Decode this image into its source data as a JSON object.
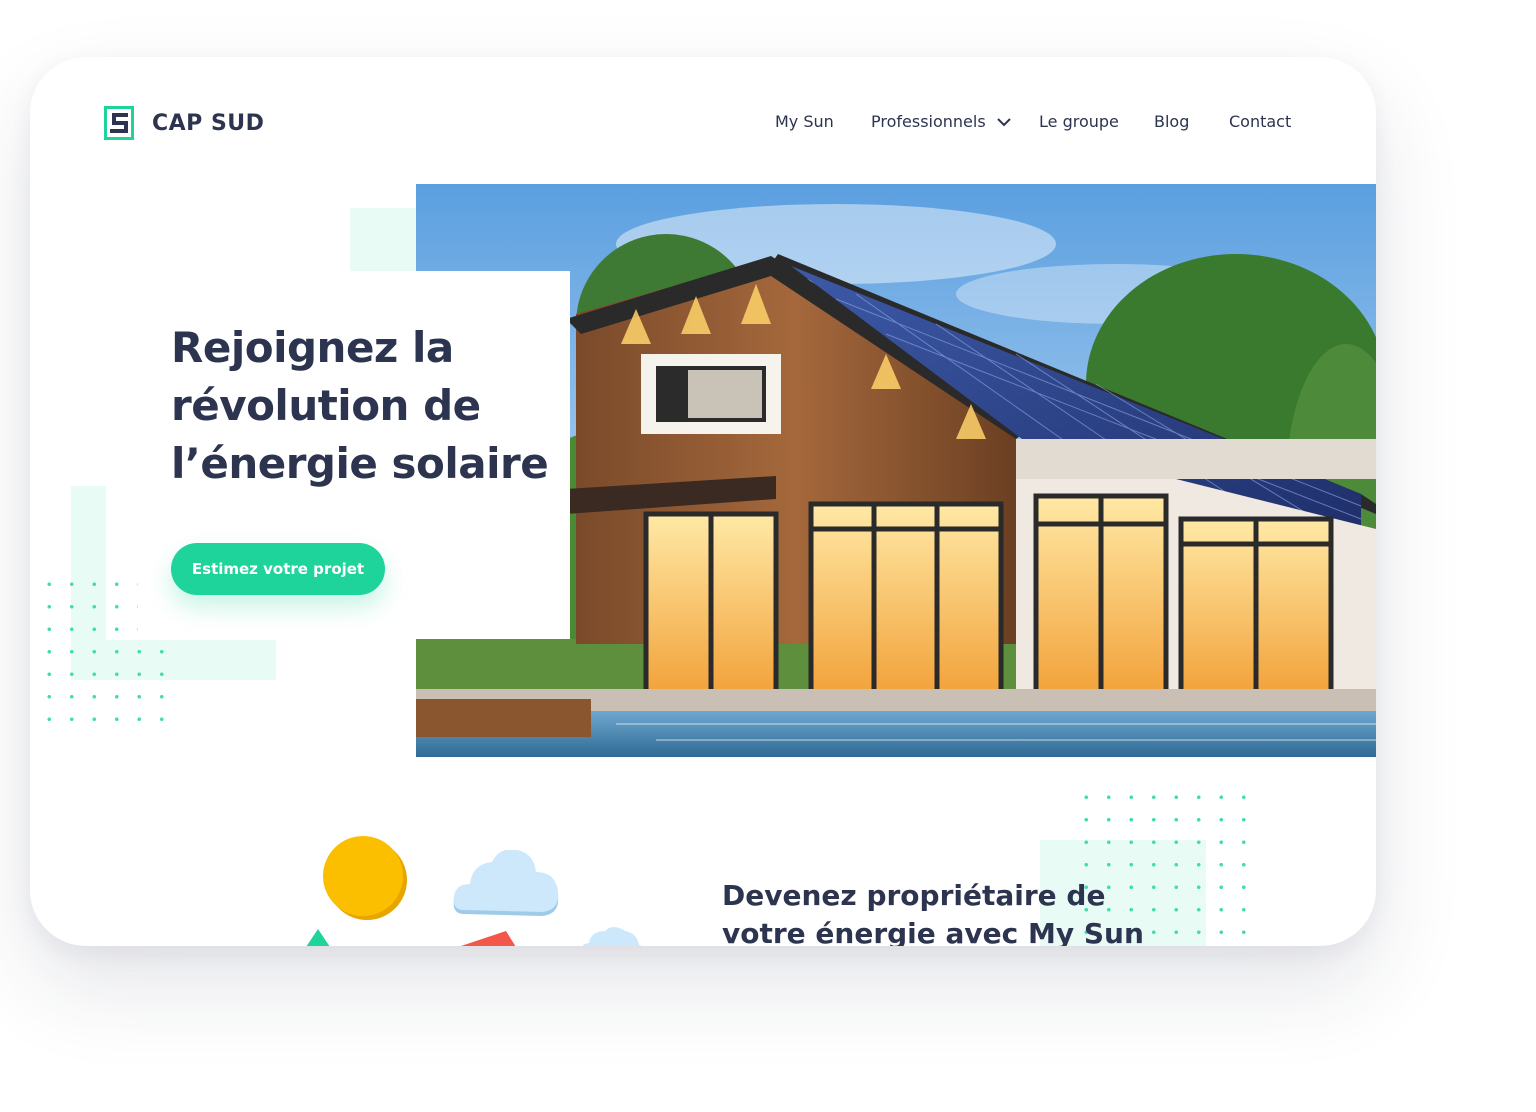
{
  "header": {
    "brand": "CAP SUD",
    "nav": [
      {
        "label": "My Sun"
      },
      {
        "label": "Professionnels",
        "has_dropdown": true
      },
      {
        "label": "Le groupe"
      },
      {
        "label": "Blog"
      },
      {
        "label": "Contact"
      }
    ]
  },
  "hero": {
    "title": "Rejoignez la révolution de l’énergie solaire",
    "cta_label": "Estimez votre projet"
  },
  "section": {
    "title": "Devenez propriétaire de votre énergie avec My Sun"
  },
  "colors": {
    "accent": "#1fd49b",
    "text": "#2c344f",
    "mint": "#e9fbf5",
    "sun": "#fbbf00",
    "cloud": "#cde8fb"
  },
  "icons": [
    "logo-mark-icon",
    "chevron-down-icon",
    "sun-icon",
    "cloud-icon",
    "triangle-icon"
  ]
}
